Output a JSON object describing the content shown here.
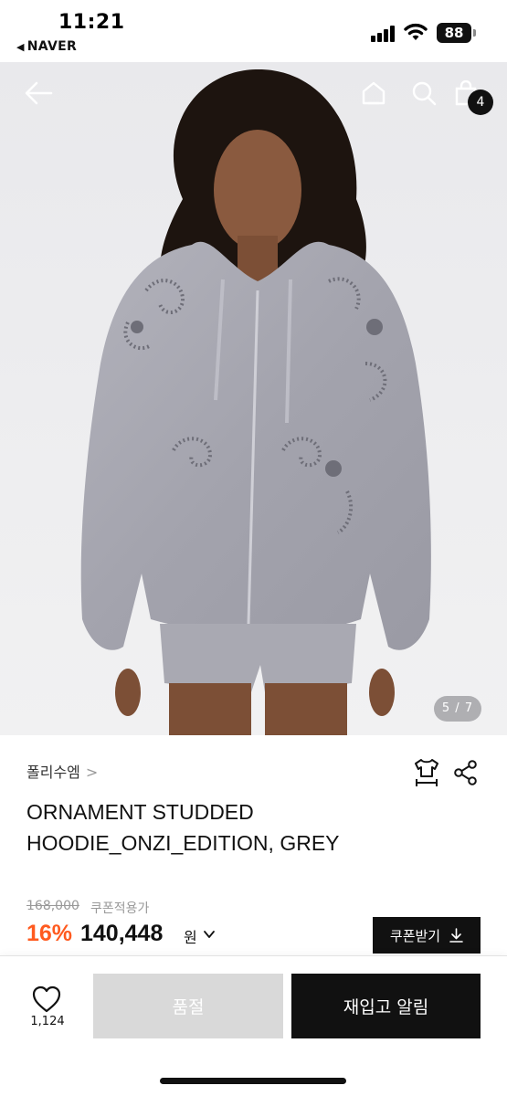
{
  "status_bar": {
    "time": "11:21",
    "back_app": "NAVER",
    "battery": "88"
  },
  "gallery": {
    "counter": "5 / 7",
    "cart_count": "4",
    "icons": [
      "back-arrow-icon",
      "home-icon",
      "search-icon",
      "shopping-bag-icon"
    ]
  },
  "product": {
    "brand": "폴리수엠",
    "brand_chevron": ">",
    "title": "ORNAMENT STUDDED HOODIE_ONZI_EDITION, GREY",
    "original_price": "168,000",
    "coupon_note": "쿠폰적용가",
    "discount": "16%",
    "sale_price": "140,448",
    "currency": "원",
    "coupon_button": "쿠폰받기"
  },
  "bottom_bar": {
    "like_count": "1,124",
    "soldout_label": "품절",
    "restock_label": "재입고 알림"
  },
  "colors": {
    "discount": "#ff5a1f",
    "primary_button": "#111111",
    "disabled_button": "#d9d9d9",
    "hoodie": "#a4a4ae"
  }
}
